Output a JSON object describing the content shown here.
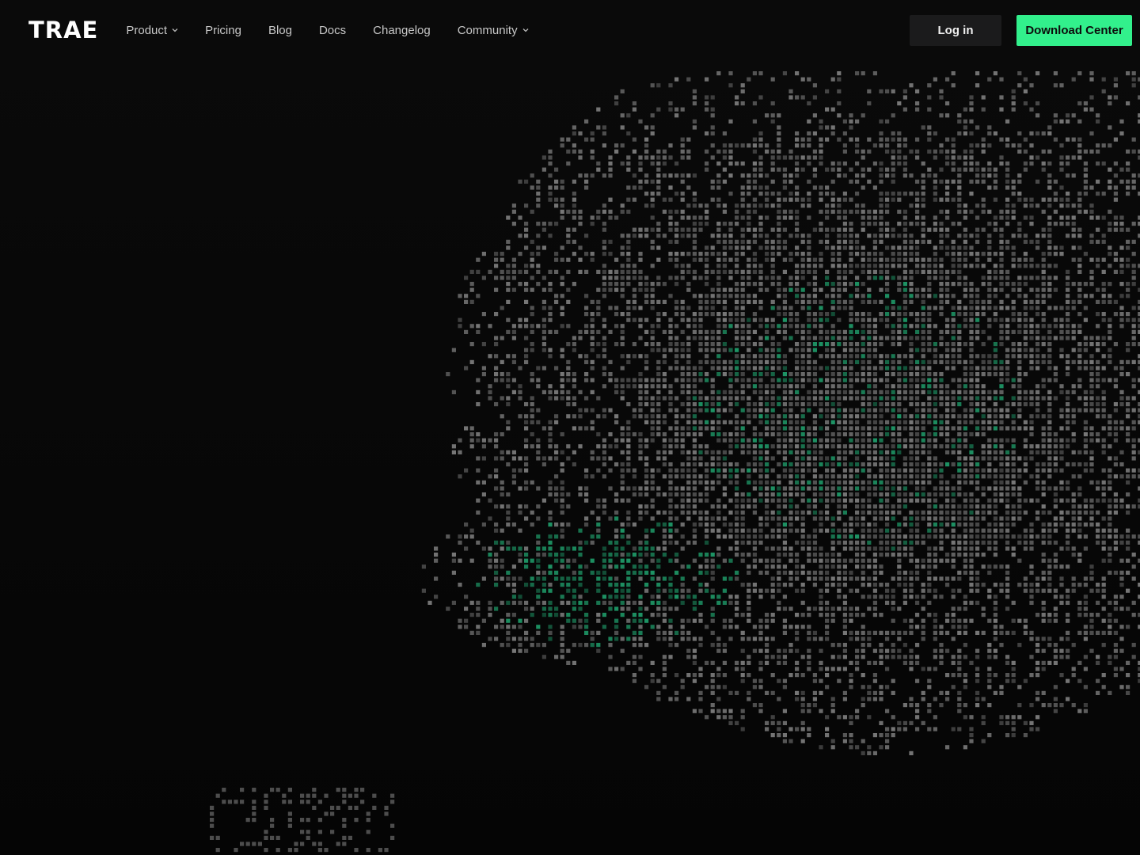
{
  "brand": {
    "logo_text": "TRAE"
  },
  "nav": {
    "items": [
      {
        "label": "Product",
        "dropdown": true
      },
      {
        "label": "Pricing",
        "dropdown": false
      },
      {
        "label": "Blog",
        "dropdown": false
      },
      {
        "label": "Docs",
        "dropdown": false
      },
      {
        "label": "Changelog",
        "dropdown": false
      },
      {
        "label": "Community",
        "dropdown": true
      }
    ]
  },
  "actions": {
    "login_label": "Log in",
    "download_label": "Download Center"
  },
  "colors": {
    "background": "#060606",
    "accent": "#32f08c",
    "particle_gray": "#7d7d7d",
    "particle_green": "#1f9c6a"
  },
  "icons": {
    "dropdown": "chevron-down-icon"
  }
}
